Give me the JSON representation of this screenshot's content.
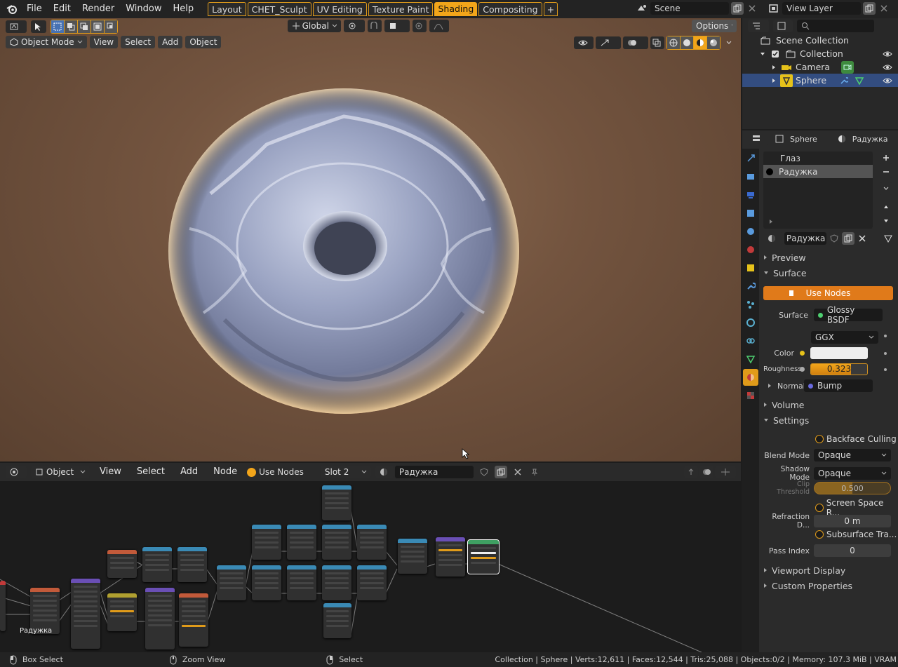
{
  "topbar": {
    "menus": [
      "File",
      "Edit",
      "Render",
      "Window",
      "Help"
    ],
    "workspaces": [
      "Layout",
      "CHET_Sculpt",
      "UV Editing",
      "Texture Paint",
      "Shading",
      "Compositing"
    ],
    "active_workspace": "Shading",
    "add_tab": "+",
    "scene": "Scene",
    "view_layer": "View Layer"
  },
  "viewport": {
    "transform_orientation": "Global",
    "options": "Options",
    "mode": "Object Mode",
    "menus": [
      "View",
      "Select",
      "Add",
      "Object"
    ]
  },
  "node_editor": {
    "type": "Object",
    "menus": [
      "View",
      "Select",
      "Add",
      "Node"
    ],
    "use_nodes": "Use Nodes",
    "slot": "Slot 2",
    "material": "Радужка",
    "frame_label": "Радужка"
  },
  "outliner": {
    "search_placeholder": "",
    "items": [
      {
        "label": "Scene Collection",
        "indent": 0
      },
      {
        "label": "Collection",
        "indent": 1
      },
      {
        "label": "Camera",
        "indent": 2
      },
      {
        "label": "Sphere",
        "indent": 2
      }
    ]
  },
  "properties": {
    "object": "Sphere",
    "material": "Радужка",
    "slots": [
      "Глаз",
      "Радужка"
    ],
    "material_name": "Радужка",
    "preview": "Preview",
    "surface_panel": "Surface",
    "use_nodes": "Use Nodes",
    "surface_label": "Surface",
    "surface_shader": "Glossy BSDF",
    "distribution": "GGX",
    "color_label": "Color",
    "roughness_label": "Roughness",
    "roughness_value": "0.323",
    "roughness_fraction": 0.323,
    "normal_label": "Normal",
    "normal_value": "Bump",
    "volume_panel": "Volume",
    "settings_panel": "Settings",
    "backface_culling": "Backface Culling",
    "blend_mode_label": "Blend Mode",
    "blend_mode": "Opaque",
    "shadow_mode_label": "Shadow Mode",
    "shadow_mode": "Opaque",
    "clip_threshold_label": "Clip Threshold",
    "clip_threshold": "0.500",
    "screen_space": "Screen Space R...",
    "refraction_label": "Refraction D...",
    "refraction_value": "0 m",
    "subsurface": "Subsurface Tra...",
    "pass_index_label": "Pass Index",
    "pass_index": "0",
    "viewport_display": "Viewport Display",
    "custom_properties": "Custom Properties"
  },
  "statusbar": {
    "left1": "Box Select",
    "left2": "Zoom View",
    "left3": "Select",
    "stats": "Collection | Sphere | Verts:12,611 | Faces:12,544 | Tris:25,088 | Objects:0/2 | Memory: 107.3 MiB | VRAM"
  },
  "colors": {
    "accent": "#e09b1a",
    "selected": "#334d80",
    "panel": "#2b2b2b"
  }
}
